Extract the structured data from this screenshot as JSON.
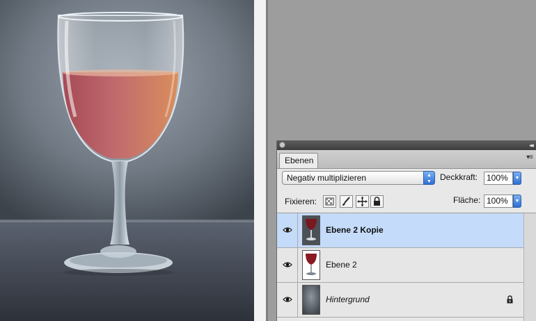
{
  "panel": {
    "tab_label": "Ebenen",
    "blend_mode": "Negativ multiplizieren",
    "opacity_label": "Deckkraft:",
    "opacity_value": "100%",
    "lock_label": "Fixieren:",
    "fill_label": "Fläche:",
    "fill_value": "100%"
  },
  "layers": [
    {
      "name": "Ebene 2 Kopie",
      "selected": true
    },
    {
      "name": "Ebene 2",
      "selected": false
    },
    {
      "name": "Hintergrund",
      "selected": false
    }
  ],
  "colors": {
    "selection": "#c4dbf9",
    "accent_blue": "#2c6fd6",
    "wine": "#b8505a"
  },
  "icons": [
    "close-icon",
    "collapse-icon",
    "panel-menu-icon",
    "eye-icon",
    "lock-transparent-icon",
    "lock-image-icon",
    "move-icon",
    "lock-icon"
  ]
}
